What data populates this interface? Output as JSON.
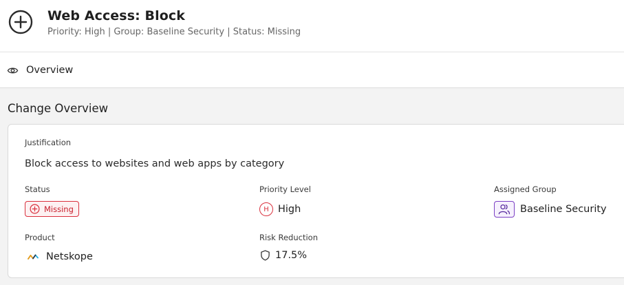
{
  "header": {
    "title": "Web Access: Block",
    "subtitle": "Priority: High | Group: Baseline Security | Status: Missing",
    "icon": "plus-circle-icon"
  },
  "tabs": [
    {
      "label": "Overview",
      "icon": "eye-icon"
    }
  ],
  "section": {
    "title": "Change Overview"
  },
  "card": {
    "justification_label": "Justification",
    "justification_text": "Block access to websites and web apps by category",
    "status_label": "Status",
    "status_value": "Missing",
    "priority_label": "Priority Level",
    "priority_badge": "H",
    "priority_value": "High",
    "group_label": "Assigned Group",
    "group_value": "Baseline Security",
    "product_label": "Product",
    "product_value": "Netskope",
    "risk_label": "Risk Reduction",
    "risk_value": "17.5%"
  },
  "colors": {
    "status_red": "#d9303d",
    "group_purple": "#7b3fc4",
    "content_bg": "#f3f3f3"
  }
}
